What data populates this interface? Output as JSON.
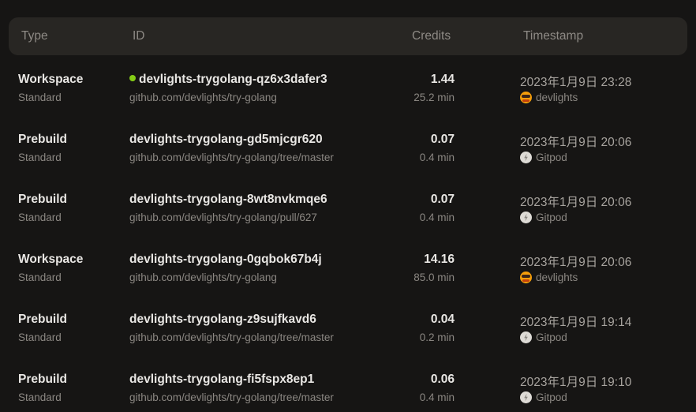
{
  "header": {
    "type": "Type",
    "id": "ID",
    "credits": "Credits",
    "timestamp": "Timestamp"
  },
  "rows": [
    {
      "type": "Workspace",
      "subtype": "Standard",
      "id": "devlights-trygolang-qz6x3dafer3",
      "running": true,
      "context": "github.com/devlights/try-golang",
      "credits": "1.44",
      "duration": "25.2 min",
      "timestamp": "2023年1月9日 23:28",
      "owner": "devlights",
      "owner_icon": "user-avatar-icon"
    },
    {
      "type": "Prebuild",
      "subtype": "Standard",
      "id": "devlights-trygolang-gd5mjcgr620",
      "running": false,
      "context": "github.com/devlights/try-golang/tree/master",
      "credits": "0.07",
      "duration": "0.4 min",
      "timestamp": "2023年1月9日 20:06",
      "owner": "Gitpod",
      "owner_icon": "gitpod-icon"
    },
    {
      "type": "Prebuild",
      "subtype": "Standard",
      "id": "devlights-trygolang-8wt8nvkmqe6",
      "running": false,
      "context": "github.com/devlights/try-golang/pull/627",
      "credits": "0.07",
      "duration": "0.4 min",
      "timestamp": "2023年1月9日 20:06",
      "owner": "Gitpod",
      "owner_icon": "gitpod-icon"
    },
    {
      "type": "Workspace",
      "subtype": "Standard",
      "id": "devlights-trygolang-0gqbok67b4j",
      "running": false,
      "context": "github.com/devlights/try-golang",
      "credits": "14.16",
      "duration": "85.0 min",
      "timestamp": "2023年1月9日 20:06",
      "owner": "devlights",
      "owner_icon": "user-avatar-icon"
    },
    {
      "type": "Prebuild",
      "subtype": "Standard",
      "id": "devlights-trygolang-z9sujfkavd6",
      "running": false,
      "context": "github.com/devlights/try-golang/tree/master",
      "credits": "0.04",
      "duration": "0.2 min",
      "timestamp": "2023年1月9日 19:14",
      "owner": "Gitpod",
      "owner_icon": "gitpod-icon"
    },
    {
      "type": "Prebuild",
      "subtype": "Standard",
      "id": "devlights-trygolang-fi5fspx8ep1",
      "running": false,
      "context": "github.com/devlights/try-golang/tree/master",
      "credits": "0.06",
      "duration": "0.4 min",
      "timestamp": "2023年1月9日 19:10",
      "owner": "Gitpod",
      "owner_icon": "gitpod-icon"
    }
  ],
  "colors": {
    "background": "#161514",
    "header_bg": "#282623",
    "running_dot": "#84cc16"
  }
}
